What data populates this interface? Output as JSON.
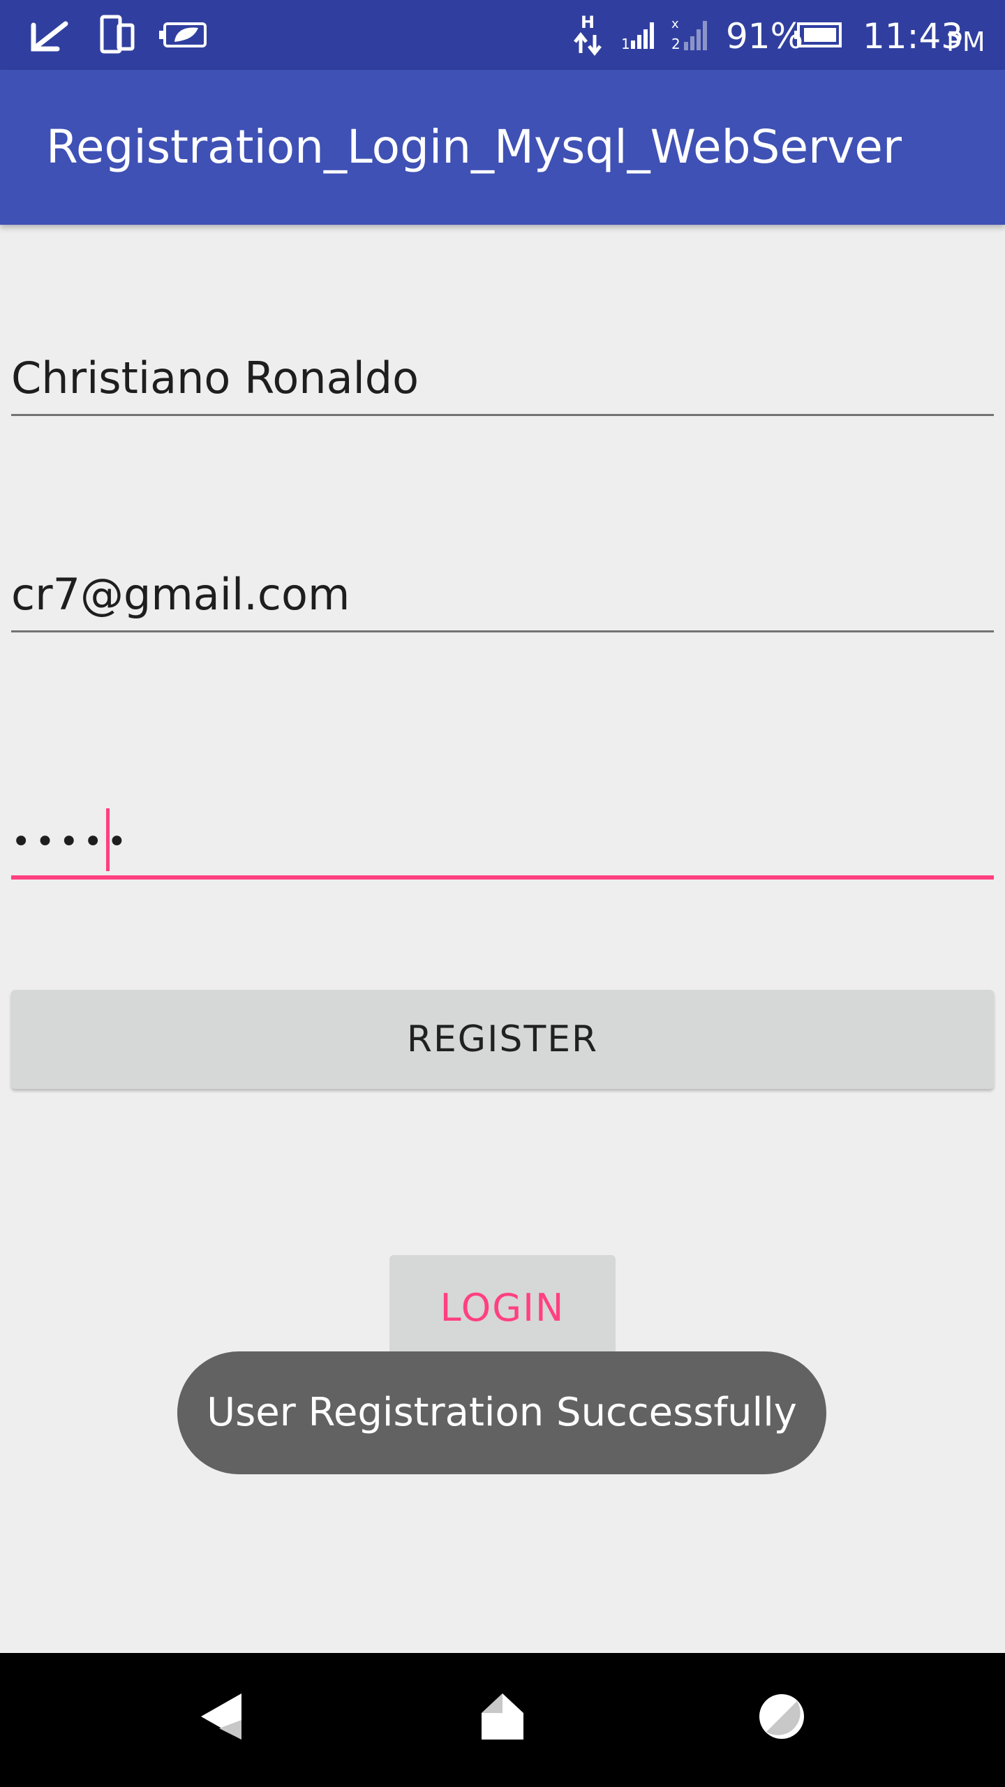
{
  "status_bar": {
    "battery_percent": "91%",
    "time": "11:43",
    "ampm": "PM",
    "network_type": "H",
    "icons": [
      "notification-check-icon",
      "device-icon",
      "battery-saver-icon",
      "data-transfer-icon",
      "signal-sim1-icon",
      "signal-sim2-icon",
      "battery-icon"
    ]
  },
  "app_bar": {
    "title": "Registration_Login_Mysql_WebServer"
  },
  "form": {
    "name_value": "Christiano Ronaldo",
    "email_value": "cr7@gmail.com",
    "password_masked": "•••••",
    "register_label": "REGISTER",
    "login_label": "LOGIN"
  },
  "toast": {
    "message": "User Registration Successfully"
  },
  "nav_bar": {
    "icons": [
      "back-icon",
      "home-icon",
      "recents-icon"
    ]
  },
  "colors": {
    "status_bar": "#303f9f",
    "app_bar": "#3f51b5",
    "accent": "#ff4081",
    "background": "#eeeeee",
    "button": "#d6d7d7",
    "toast": "#626262"
  }
}
